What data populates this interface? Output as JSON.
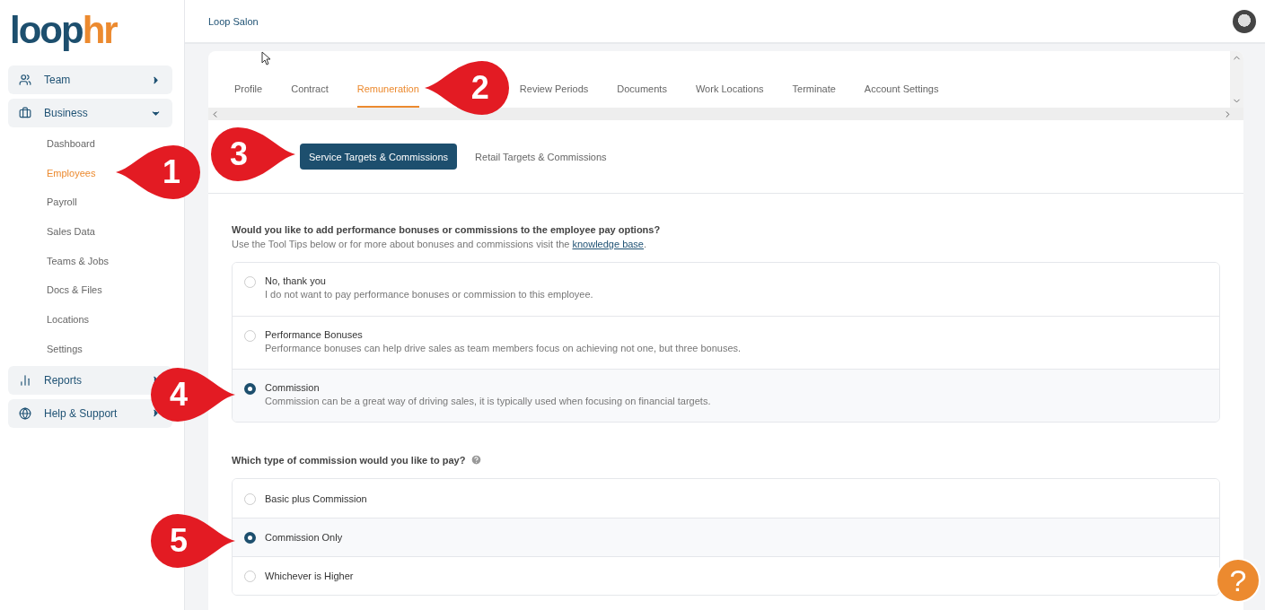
{
  "logo": {
    "first": "loop",
    "second": "hr"
  },
  "header": {
    "title": "Loop Salon"
  },
  "sidebar": {
    "groups": [
      {
        "label": "Team",
        "expanded": false
      },
      {
        "label": "Business",
        "expanded": true,
        "items": [
          {
            "label": "Dashboard",
            "selected": false
          },
          {
            "label": "Employees",
            "selected": true
          },
          {
            "label": "Payroll",
            "selected": false
          },
          {
            "label": "Sales Data",
            "selected": false
          },
          {
            "label": "Teams & Jobs",
            "selected": false
          },
          {
            "label": "Docs & Files",
            "selected": false
          },
          {
            "label": "Locations",
            "selected": false
          },
          {
            "label": "Settings",
            "selected": false
          }
        ]
      },
      {
        "label": "Reports",
        "expanded": false
      },
      {
        "label": "Help & Support",
        "expanded": false
      }
    ]
  },
  "tabs": [
    {
      "label": "Profile",
      "selected": false
    },
    {
      "label": "Contract",
      "selected": false
    },
    {
      "label": "Remuneration",
      "selected": true
    },
    {
      "label": "Review Periods",
      "selected": false
    },
    {
      "label": "Documents",
      "selected": false
    },
    {
      "label": "Work Locations",
      "selected": false
    },
    {
      "label": "Terminate",
      "selected": false
    },
    {
      "label": "Account Settings",
      "selected": false
    }
  ],
  "subtabs": [
    {
      "label": "Service Targets & Commissions",
      "selected": true
    },
    {
      "label": "Retail Targets & Commissions",
      "selected": false
    }
  ],
  "questions": [
    {
      "title": "Would you like to add performance bonuses or commissions to the employee pay options?",
      "hint_before": "Use the Tool Tips below or for more about bonuses and commissions visit the ",
      "hint_link": "knowledge base",
      "hint_after": ".",
      "options": [
        {
          "label": "No, thank you",
          "description": "I do not want to pay performance bonuses or commission to this employee.",
          "selected": false
        },
        {
          "label": "Performance Bonuses",
          "description": "Performance bonuses can help drive sales as team members focus on achieving not one, but three bonuses.",
          "selected": false
        },
        {
          "label": "Commission",
          "description": "Commission can be a great way of driving sales, it is typically used when focusing on financial targets.",
          "selected": true
        }
      ]
    },
    {
      "title": "Which type of commission would you like to pay?",
      "help": true,
      "options": [
        {
          "label": "Basic plus Commission",
          "selected": false
        },
        {
          "label": "Commission Only",
          "selected": true
        },
        {
          "label": "Whichever is Higher",
          "selected": false
        }
      ]
    }
  ],
  "callouts": [
    {
      "label": "1"
    },
    {
      "label": "2"
    },
    {
      "label": "3"
    },
    {
      "label": "4"
    },
    {
      "label": "5"
    }
  ],
  "help_button": {
    "label": "?"
  }
}
